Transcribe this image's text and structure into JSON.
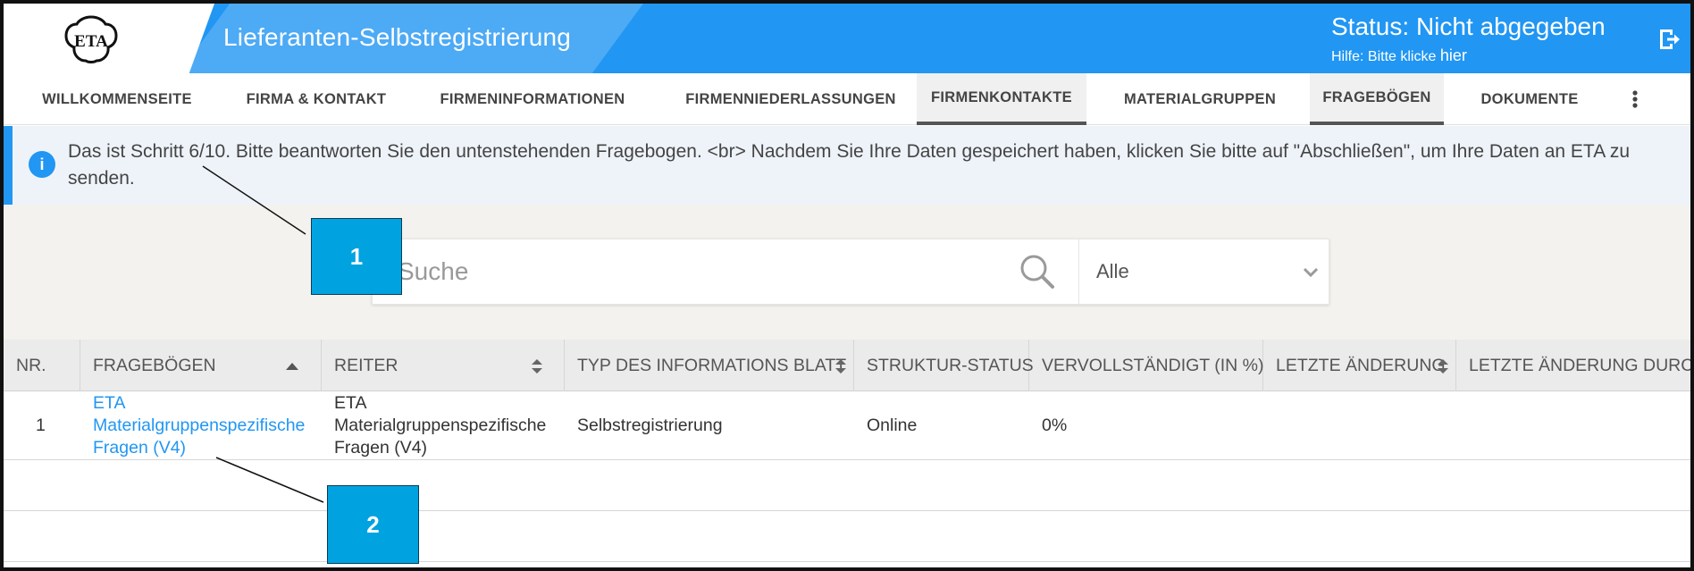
{
  "header": {
    "logo_text": "ETA",
    "app_title": "Lieferanten-Selbstregistrierung",
    "status": "Status: Nicht abgegeben",
    "help_prefix": "Hilfe: Bitte klicke ",
    "help_link": "hier",
    "logout_icon": "logout-icon"
  },
  "nav": {
    "tabs": [
      {
        "label": "WILLKOMMENSEITE",
        "active": false
      },
      {
        "label": "FIRMA & KONTAKT",
        "active": false
      },
      {
        "label": "FIRMENINFORMATIONEN",
        "active": false
      },
      {
        "label": "FIRMENNIEDERLASSUNGEN",
        "active": false
      },
      {
        "label": "FIRMENKONTAKTE",
        "active": true
      },
      {
        "label": "MATERIALGRUPPEN",
        "active": false
      },
      {
        "label": "FRAGEBÖGEN",
        "active": true
      },
      {
        "label": "DOKUMENTE",
        "active": false
      }
    ],
    "more_icon": "more-vertical-icon"
  },
  "info": {
    "text": "Das ist Schritt 6/10. Bitte beantworten Sie den untenstehenden Fragebogen. <br> Nachdem Sie Ihre Daten gespeichert haben, klicken Sie bitte auf \"Abschließen\", um Ihre Daten an ETA zu senden.",
    "icon": "info-icon",
    "accent": "#2196f3"
  },
  "search": {
    "placeholder": "Suche",
    "filter_value": "Alle"
  },
  "table": {
    "columns": [
      "NR.",
      "FRAGEBÖGEN",
      "REITER",
      "TYP DES INFORMATIONS BLATT",
      "STRUKTUR-STATUS",
      "VERVOLLSTÄNDIGT (IN %)",
      "LETZTE ÄNDERUNG",
      "LETZTE ÄNDERUNG DURCH"
    ],
    "rows": [
      {
        "nr": "1",
        "fragebogen": "ETA Materialgruppenspezifische Fragen (V4)",
        "reiter": "ETA Materialgruppenspezifische Fragen (V4)",
        "typ": "Selbstregistrierung",
        "status": "Online",
        "vervollstaendigt": "0%",
        "letzte_aenderung": "",
        "letzte_aenderung_durch": ""
      }
    ]
  },
  "callouts": [
    "1",
    "2"
  ],
  "colors": {
    "header_blue": "#2196f3",
    "header_light_blue": "#4daaf5",
    "callout_blue": "#00a3e0",
    "link_blue": "#2196f3"
  }
}
